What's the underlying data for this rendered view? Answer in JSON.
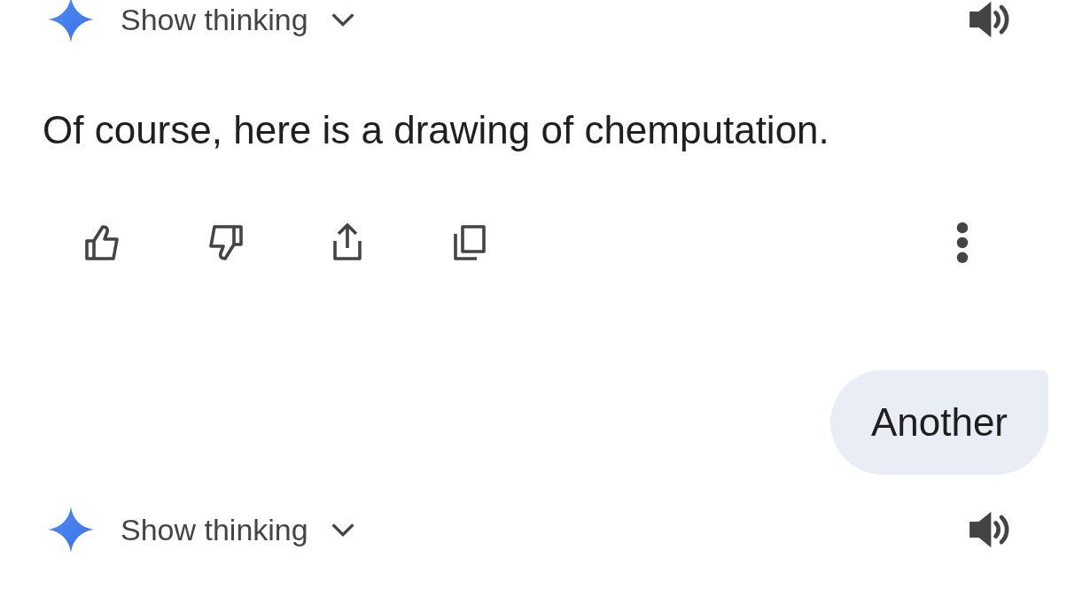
{
  "responses": [
    {
      "thinking_label": "Show thinking",
      "message": "Of course, here is a drawing of chemputation."
    },
    {
      "user_message": "Another"
    },
    {
      "thinking_label": "Show thinking"
    }
  ]
}
